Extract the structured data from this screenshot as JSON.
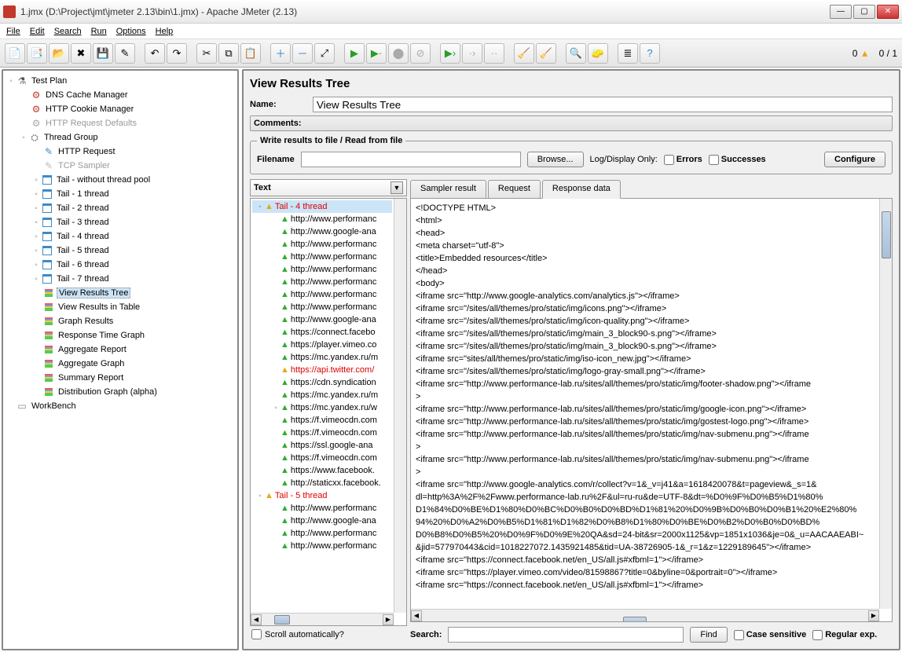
{
  "title": "1.jmx (D:\\Project\\jmt\\jmeter 2.13\\bin\\1.jmx) - Apache JMeter (2.13)",
  "menu": [
    "File",
    "Edit",
    "Search",
    "Run",
    "Options",
    "Help"
  ],
  "counters": {
    "warn": "0",
    "threads": "0 / 1"
  },
  "tree": {
    "testplan": "Test Plan",
    "dns": "DNS Cache Manager",
    "cookie": "HTTP Cookie Manager",
    "defaults": "HTTP Request Defaults",
    "tg": "Thread Group",
    "http": "HTTP Request",
    "tcp": "TCP Sampler",
    "tails": [
      "Tail - without thread pool",
      "Tail - 1 thread",
      "Tail - 2 thread",
      "Tail - 3 thread",
      "Tail - 4 thread",
      "Tail - 5 thread",
      "Tail - 6 thread",
      "Tail - 7 thread"
    ],
    "listeners": [
      "View Results Tree",
      "View Results in Table",
      "Graph Results",
      "Response Time Graph",
      "Aggregate Report",
      "Aggregate Graph",
      "Summary Report",
      "Distribution Graph (alpha)"
    ],
    "wb": "WorkBench"
  },
  "panel": {
    "title": "View Results Tree",
    "name_lbl": "Name:",
    "name_val": "View Results Tree",
    "comments_lbl": "Comments:",
    "fs_legend": "Write results to file / Read from file",
    "filename_lbl": "Filename",
    "filename_val": "",
    "browse": "Browse...",
    "logonly": "Log/Display Only:",
    "errors": "Errors",
    "successes": "Successes",
    "configure": "Configure"
  },
  "combo": "Text",
  "results": {
    "hdr4": "Tail - 4 thread",
    "items4": [
      "http://www.performanc",
      "http://www.google-ana",
      "http://www.performanc",
      "http://www.performanc",
      "http://www.performanc",
      "http://www.performanc",
      "http://www.performanc",
      "http://www.performanc",
      "http://www.google-ana",
      "https://connect.facebo",
      "https://player.vimeo.co",
      "https://mc.yandex.ru/m",
      "https://api.twitter.com/",
      "https://cdn.syndication",
      "https://mc.yandex.ru/m",
      "https://mc.yandex.ru/w",
      "https://f.vimeocdn.com",
      "https://f.vimeocdn.com",
      "https://ssl.google-ana",
      "https://f.vimeocdn.com",
      "https://www.facebook.",
      "http://staticxx.facebook."
    ],
    "err_idx": 12,
    "hdr5": "Tail - 5 thread",
    "items5": [
      "http://www.performanc",
      "http://www.google-ana",
      "http://www.performanc",
      "http://www.performanc"
    ]
  },
  "scroll_lbl": "Scroll automatically?",
  "tabs": [
    "Sampler result",
    "Request",
    "Response data"
  ],
  "response_lines": [
    "<!DOCTYPE HTML>",
    "<html>",
    "<head>",
    "  <meta charset=\"utf-8\">",
    "  <title>Embedded resources</title>",
    "</head>",
    "<body>",
    "  <iframe src=\"http://www.google-analytics.com/analytics.js\"></iframe>",
    "  <iframe src=\"/sites/all/themes/pro/static/img/icons.png\"></iframe>",
    "  <iframe src=\"/sites/all/themes/pro/static/img/icon-quality.png\"></iframe>",
    "  <iframe src=\"/sites/all/themes/pro/static/img/main_3_block90-s.png\"></iframe>",
    "  <iframe src=\"/sites/all/themes/pro/static/img/main_3_block90-s.png\"></iframe>",
    "  <iframe src=\"sites/all/themes/pro/static/img/iso-icon_new.jpg\"></iframe>",
    "  <iframe src=\"/sites/all/themes/pro/static/img/logo-gray-small.png\"></iframe>",
    "  <iframe src=\"http://www.performance-lab.ru/sites/all/themes/pro/static/img/footer-shadow.png\"></iframe",
    ">",
    "  <iframe src=\"http://www.performance-lab.ru/sites/all/themes/pro/static/img/google-icon.png\"></iframe>",
    "  <iframe src=\"http://www.performance-lab.ru/sites/all/themes/pro/static/img/gostest-logo.png\"></iframe>",
    "  <iframe src=\"http://www.performance-lab.ru/sites/all/themes/pro/static/img/nav-submenu.png\"></iframe",
    ">",
    "  <iframe src=\"http://www.performance-lab.ru/sites/all/themes/pro/static/img/nav-submenu.png\"></iframe",
    ">",
    "  <iframe src=\"http://www.google-analytics.com/r/collect?v=1&_v=j41&a=1618420078&t=pageview&_s=1&",
    "dl=http%3A%2F%2Fwww.performance-lab.ru%2F&ul=ru-ru&de=UTF-8&dt=%D0%9F%D0%B5%D1%80%",
    "D1%84%D0%BE%D1%80%D0%BC%D0%B0%D0%BD%D1%81%20%D0%9B%D0%B0%D0%B1%20%E2%80%",
    "94%20%D0%A2%D0%B5%D1%81%D1%82%D0%B8%D1%80%D0%BE%D0%B2%D0%B0%D0%BD%",
    "D0%B8%D0%B5%20%D0%9F%D0%9E%20QA&sd=24-bit&sr=2000x1125&vp=1851x1036&je=0&_u=AACAAEABI~",
    "&jid=577970443&cid=1018227072.1435921485&tid=UA-38726905-1&_r=1&z=1229189645\"></iframe>",
    "  <iframe src=\"https://connect.facebook.net/en_US/all.js#xfbml=1\"></iframe>",
    "  <iframe src=\"https://player.vimeo.com/video/81598867?title=0&byline=0&portrait=0\"></iframe>",
    "  <iframe src=\"https://connect.facebook.net/en_US/all.js#xfbml=1\"></iframe>"
  ],
  "search": {
    "lbl": "Search:",
    "find": "Find",
    "cs": "Case sensitive",
    "re": "Regular exp."
  }
}
